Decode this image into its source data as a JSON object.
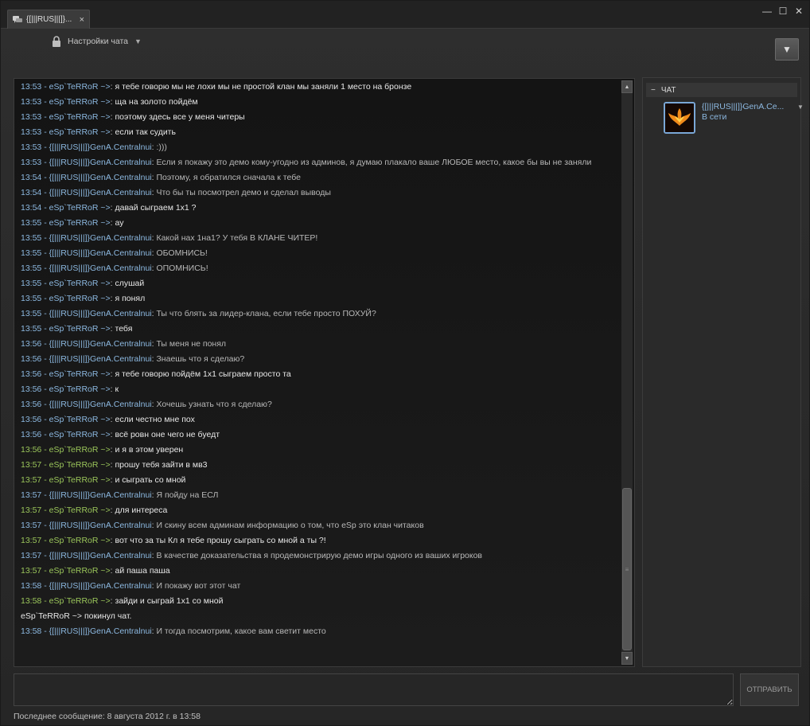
{
  "window": {
    "tab_title": "{[|||RUS|||]}...",
    "tab_close": "×",
    "minimize": "—",
    "maximize": "☐",
    "close": "✕"
  },
  "header": {
    "settings_label": "Настройки чата",
    "menu_button": "▼"
  },
  "messages": [
    {
      "head": "13:53 - eSp`TeRRoR ~>",
      "color": "blue",
      "text": "я тебе говорю мы не лохи мы не простой клан мы заняли 1 место на бронзе",
      "tone": "bright"
    },
    {
      "head": "13:53 - eSp`TeRRoR ~>",
      "color": "blue",
      "text": "ща на золото пойдём",
      "tone": "bright"
    },
    {
      "head": "13:53 - eSp`TeRRoR ~>",
      "color": "blue",
      "text": "поэтому здесь все у меня читеры",
      "tone": "bright"
    },
    {
      "head": "13:53 - eSp`TeRRoR ~>",
      "color": "blue",
      "text": "если так судить",
      "tone": "bright"
    },
    {
      "head": "13:53 - {[|||RUS|||]}GenA.Centralnui",
      "color": "blue",
      "text": ":)))",
      "tone": "dim"
    },
    {
      "head": "13:53 - {[|||RUS|||]}GenA.Centralnui",
      "color": "blue",
      "text": "Если я покажу это демо кому-угодно из админов, я думаю плакало ваше ЛЮБОЕ место, какое бы вы не заняли",
      "tone": "dim"
    },
    {
      "head": "13:54 - {[|||RUS|||]}GenA.Centralnui",
      "color": "blue",
      "text": "Поэтому, я обратился сначала к тебе",
      "tone": "dim"
    },
    {
      "head": "13:54 - {[|||RUS|||]}GenA.Centralnui",
      "color": "blue",
      "text": "Что бы ты посмотрел демо и сделал выводы",
      "tone": "dim"
    },
    {
      "head": "13:54 - eSp`TeRRoR ~>",
      "color": "blue",
      "text": "давай сыграем 1х1 ?",
      "tone": "bright"
    },
    {
      "head": "13:55 - eSp`TeRRoR ~>",
      "color": "blue",
      "text": "ау",
      "tone": "bright"
    },
    {
      "head": "13:55 - {[|||RUS|||]}GenA.Centralnui",
      "color": "blue",
      "text": "Какой нах 1на1? У тебя В КЛАНЕ ЧИТЕР!",
      "tone": "dim"
    },
    {
      "head": "13:55 - {[|||RUS|||]}GenA.Centralnui",
      "color": "blue",
      "text": "ОБОМНИСЬ!",
      "tone": "dim"
    },
    {
      "head": "13:55 - {[|||RUS|||]}GenA.Centralnui",
      "color": "blue",
      "text": "ОПОМНИСЬ!",
      "tone": "dim"
    },
    {
      "head": "13:55 - eSp`TeRRoR ~>",
      "color": "blue",
      "text": "слушай",
      "tone": "bright"
    },
    {
      "head": "13:55 - eSp`TeRRoR ~>",
      "color": "blue",
      "text": "я понял",
      "tone": "bright"
    },
    {
      "head": "13:55 - {[|||RUS|||]}GenA.Centralnui",
      "color": "blue",
      "text": "Ты что блять за лидер-клана, если тебе просто ПОХУЙ?",
      "tone": "dim"
    },
    {
      "head": "13:55 - eSp`TeRRoR ~>",
      "color": "blue",
      "text": "тебя",
      "tone": "bright"
    },
    {
      "head": "13:56 - {[|||RUS|||]}GenA.Centralnui",
      "color": "blue",
      "text": "Ты меня не понял",
      "tone": "dim"
    },
    {
      "head": "13:56 - {[|||RUS|||]}GenA.Centralnui",
      "color": "blue",
      "text": "Знаешь что я сделаю?",
      "tone": "dim"
    },
    {
      "head": "13:56 - eSp`TeRRoR ~>",
      "color": "blue",
      "text": "я тебе говорю пойдём 1х1 сыграем просто та",
      "tone": "bright"
    },
    {
      "head": "13:56 - eSp`TeRRoR ~>",
      "color": "blue",
      "text": "к",
      "tone": "bright"
    },
    {
      "head": "13:56 - {[|||RUS|||]}GenA.Centralnui",
      "color": "blue",
      "text": "Хочешь узнать что я сделаю?",
      "tone": "dim"
    },
    {
      "head": "13:56 - eSp`TeRRoR ~>",
      "color": "blue",
      "text": "если честно мне пох",
      "tone": "bright"
    },
    {
      "head": "13:56 - eSp`TeRRoR ~>",
      "color": "blue",
      "text": "всё ровн оне чего не буедт",
      "tone": "bright"
    },
    {
      "head": "13:56 - eSp`TeRRoR ~>",
      "color": "green",
      "text": "и я в этом уверен",
      "tone": "bright"
    },
    {
      "head": "13:57 - eSp`TeRRoR ~>",
      "color": "green",
      "text": "прошу тебя зайти в мв3",
      "tone": "bright"
    },
    {
      "head": "13:57 - eSp`TeRRoR ~>",
      "color": "green",
      "text": "и сыграть со мной",
      "tone": "bright"
    },
    {
      "head": "13:57 - {[|||RUS|||]}GenA.Centralnui",
      "color": "blue",
      "text": "Я пойду на ЕСЛ",
      "tone": "dim"
    },
    {
      "head": "13:57 - eSp`TeRRoR ~>",
      "color": "green",
      "text": "для интереса",
      "tone": "bright"
    },
    {
      "head": "13:57 - {[|||RUS|||]}GenA.Centralnui",
      "color": "blue",
      "text": "И скину всем админам информацию о том, что eSp это клан читаков",
      "tone": "dim"
    },
    {
      "head": "13:57 - eSp`TeRRoR ~>",
      "color": "green",
      "text": "вот что за ты Кл я тебе прошу сыграть со мной а ты ?!",
      "tone": "bright"
    },
    {
      "head": "13:57 - {[|||RUS|||]}GenA.Centralnui",
      "color": "blue",
      "text": "В качестве доказательства я продемонстрирую демо игры одного из ваших игроков",
      "tone": "dim"
    },
    {
      "head": "13:57 - eSp`TeRRoR ~>",
      "color": "green",
      "text": "ай паша паша",
      "tone": "bright"
    },
    {
      "head": "13:58 - {[|||RUS|||]}GenA.Centralnui",
      "color": "blue",
      "text": "И покажу вот этот чат",
      "tone": "dim"
    },
    {
      "head": "13:58 - eSp`TeRRoR ~>",
      "color": "green",
      "text": "зайди и сыграй 1х1 со мной",
      "tone": "bright"
    },
    {
      "system": "eSp`TeRRoR ~> покинул чат."
    },
    {
      "head": "13:58 - {[|||RUS|||]}GenA.Centralnui",
      "color": "blue",
      "text": "И тогда посмотрим, какое вам светит место",
      "tone": "dim"
    }
  ],
  "members_panel": {
    "group_collapse": "−",
    "group_label": "ЧАТ",
    "member_name": "{[|||RUS|||]}GenA.Ce...",
    "member_status": "В сети",
    "member_caret": "▼"
  },
  "composer": {
    "input_value": "",
    "send_label": "ОТПРАВИТЬ"
  },
  "status_bar": {
    "last_message": "Последнее сообщение: 8 августа 2012 г. в 13:58"
  },
  "colors": {
    "name_blue": "#8cb8e0",
    "name_green": "#9ac55a",
    "background": "#2b2b2b"
  }
}
